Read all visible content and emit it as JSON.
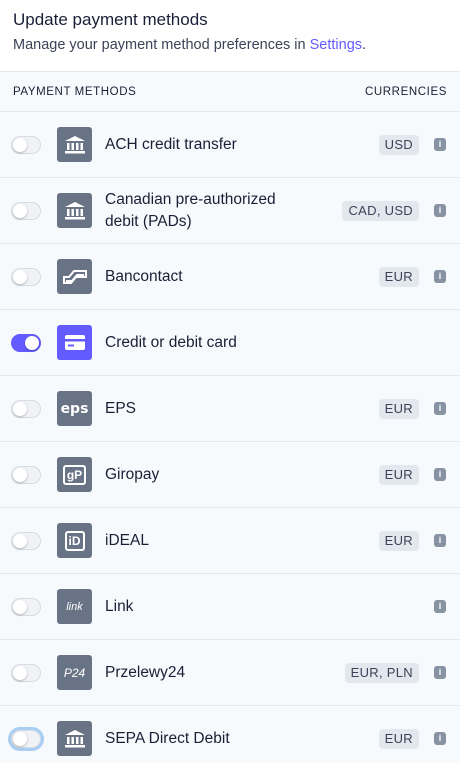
{
  "header": {
    "title": "Update payment methods",
    "subtitle_prefix": "Manage your payment method preferences in ",
    "settings_link": "Settings",
    "subtitle_suffix": "."
  },
  "columns": {
    "methods": "PAYMENT METHODS",
    "currencies": "CURRENCIES"
  },
  "methods": [
    {
      "name": "ACH credit transfer",
      "currency": "USD",
      "enabled": false,
      "icon": "bank-icon",
      "info": "i"
    },
    {
      "name": "Canadian pre-authorized debit (PADs)",
      "currency": "CAD, USD",
      "enabled": false,
      "icon": "bank-icon",
      "info": "i"
    },
    {
      "name": "Bancontact",
      "currency": "EUR",
      "enabled": false,
      "icon": "bancontact-icon",
      "info": "i"
    },
    {
      "name": "Credit or debit card",
      "currency": "",
      "enabled": true,
      "icon": "card-icon",
      "info": ""
    },
    {
      "name": "EPS",
      "currency": "EUR",
      "enabled": false,
      "icon": "eps-icon",
      "info": "i"
    },
    {
      "name": "Giropay",
      "currency": "EUR",
      "enabled": false,
      "icon": "giropay-icon",
      "info": "i"
    },
    {
      "name": "iDEAL",
      "currency": "EUR",
      "enabled": false,
      "icon": "ideal-icon",
      "info": "i"
    },
    {
      "name": "Link",
      "currency": "",
      "enabled": false,
      "icon": "link-icon",
      "info": "i"
    },
    {
      "name": "Przelewy24",
      "currency": "EUR, PLN",
      "enabled": false,
      "icon": "p24-icon",
      "info": "i"
    },
    {
      "name": "SEPA Direct Debit",
      "currency": "EUR",
      "enabled": false,
      "icon": "bank-icon",
      "info": "i"
    }
  ],
  "logo_text": {
    "eps": "eps",
    "giropay": "gP",
    "ideal": "iD",
    "link": "link",
    "p24": "P24"
  },
  "colors": {
    "accent": "#635bff",
    "logo_bg": "#697386",
    "focus_ring": "#a9cef4"
  }
}
